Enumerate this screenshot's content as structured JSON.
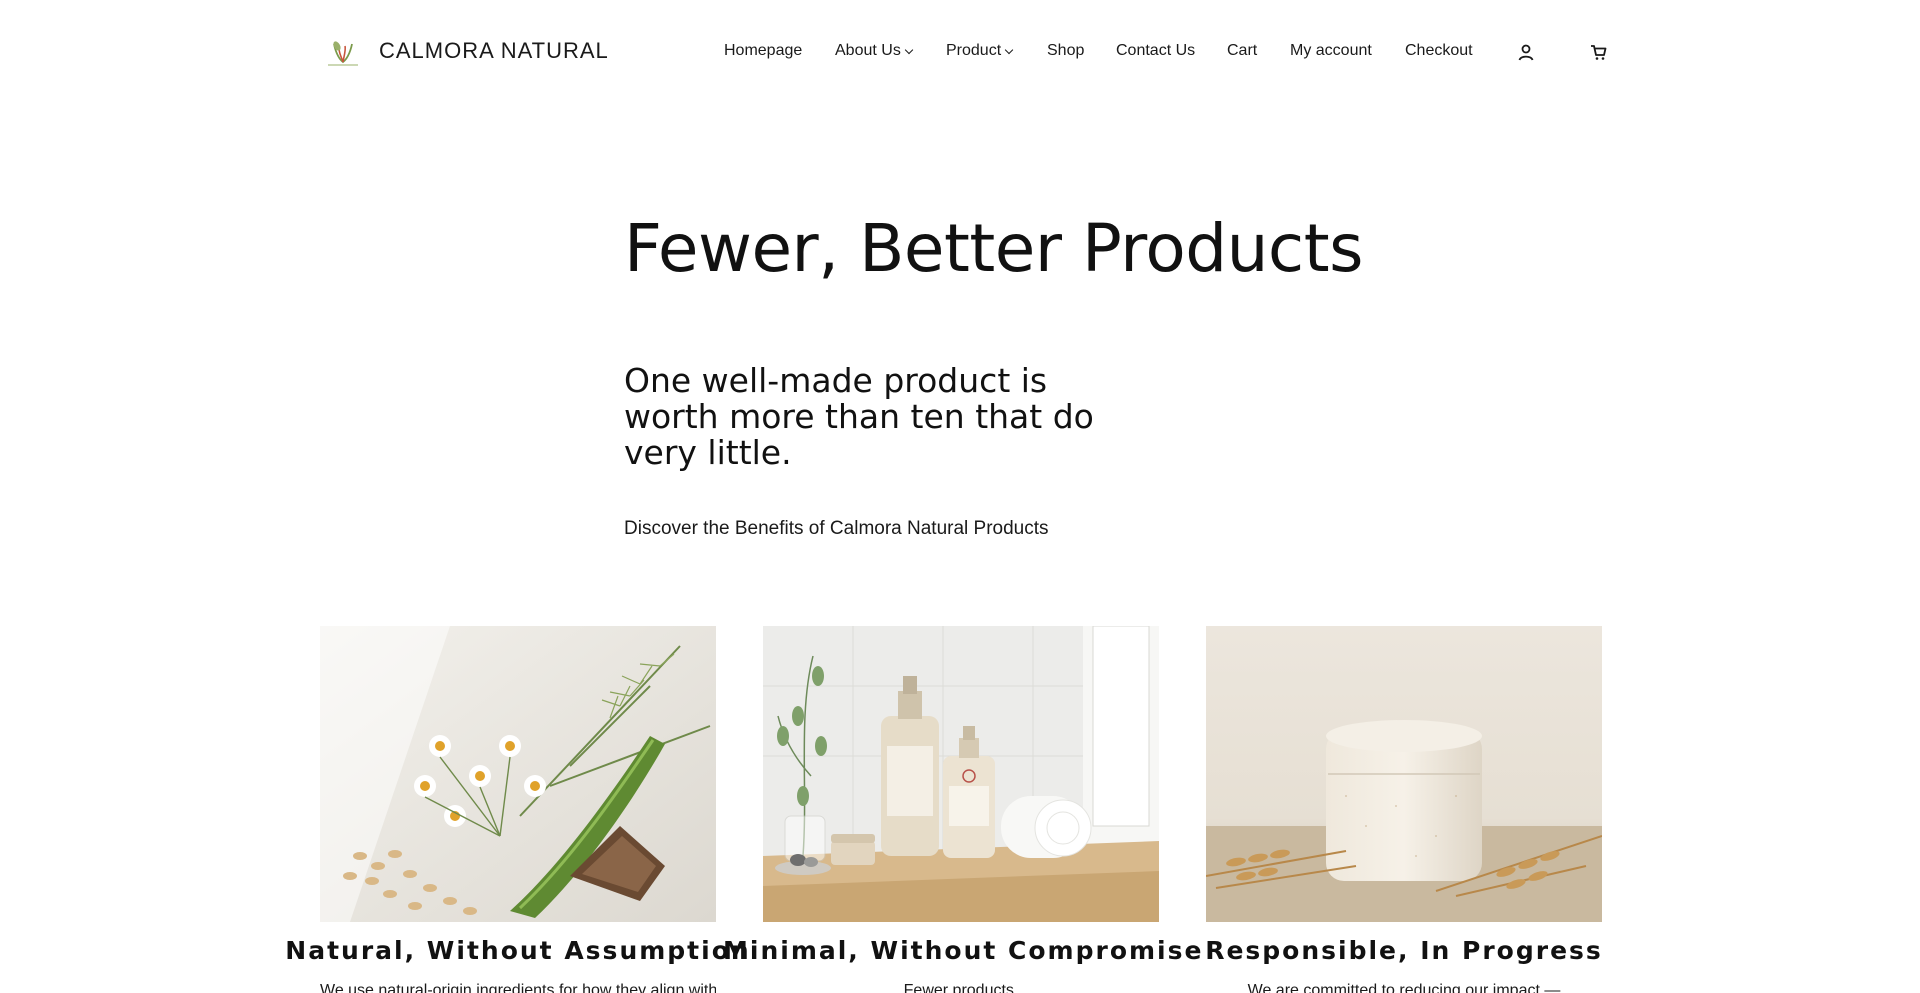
{
  "brand": {
    "name": "CALMORA NATURAL",
    "logo_icon": "leaf-logo-icon"
  },
  "nav": {
    "items": [
      {
        "label": "Homepage",
        "has_dropdown": false
      },
      {
        "label": "About Us",
        "has_dropdown": true
      },
      {
        "label": "Product",
        "has_dropdown": true
      },
      {
        "label": "Shop",
        "has_dropdown": false
      },
      {
        "label": "Contact Us",
        "has_dropdown": false
      },
      {
        "label": "Cart",
        "has_dropdown": false
      },
      {
        "label": "My account",
        "has_dropdown": false
      },
      {
        "label": "Checkout",
        "has_dropdown": false
      }
    ],
    "icons": {
      "account": "user-icon",
      "cart": "cart-icon"
    }
  },
  "hero": {
    "title": "Fewer, Better Products",
    "subtitle": "One well-made product is worth more than ten that do very little.",
    "link": "Discover the Benefits of Calmora Natural Products"
  },
  "cards": [
    {
      "title": "Natural, Without Assumption",
      "text": "We use natural-origin ingredients for how they align with",
      "image": "botanicals-image"
    },
    {
      "title": "Minimal, Without Compromise",
      "text": "Fewer products.",
      "image": "bottles-image"
    },
    {
      "title": "Responsible, In Progress",
      "text": "We are committed to reducing our impact —",
      "image": "jar-image"
    }
  ],
  "colors": {
    "text": "#1a1a1a",
    "background": "#ffffff",
    "accent_green": "#5a8a3a"
  }
}
